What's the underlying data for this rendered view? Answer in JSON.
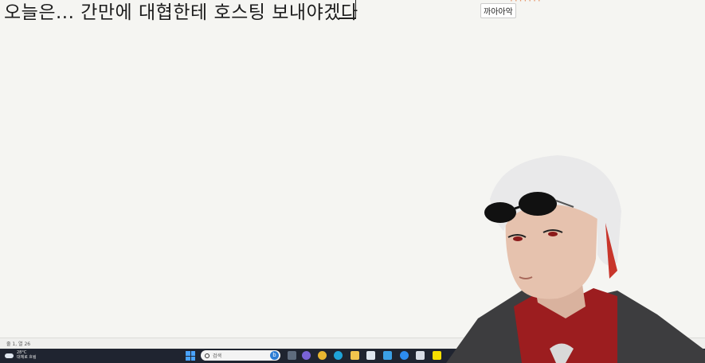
{
  "editor": {
    "text": "오늘은... 간만에 대협한테 호스팅 보내야겠다"
  },
  "chat": {
    "tag": "까아아악",
    "dots": "·······"
  },
  "statusbar": {
    "position": "줄 1, 열 26"
  },
  "taskbar": {
    "weather_temp": "28°C",
    "weather_desc": "대체로 흐림",
    "search_placeholder": "검색",
    "bing_label": "b"
  },
  "colors": {
    "editor_bg": "#f5f5f2",
    "taskbar_bg": "#1f2430",
    "accent": "#4aa3ff"
  }
}
